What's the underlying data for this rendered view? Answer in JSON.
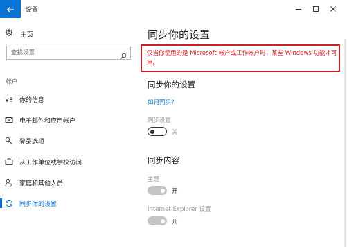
{
  "window": {
    "title": "设置",
    "back_icon": "arrow-left-icon",
    "controls": [
      "minimize-icon",
      "maximize-icon",
      "close-icon"
    ]
  },
  "sidebar": {
    "home_label": "主页",
    "search_placeholder": "查找设置",
    "section_label": "帐户",
    "items": [
      {
        "label": "你的信息",
        "icon": "person-card-icon",
        "active": false
      },
      {
        "label": "电子邮件和应用帐户",
        "icon": "mail-icon",
        "active": false
      },
      {
        "label": "登录选项",
        "icon": "key-icon",
        "active": false
      },
      {
        "label": "从工作单位或学校访问",
        "icon": "briefcase-icon",
        "active": false
      },
      {
        "label": "家庭和其他人员",
        "icon": "person-add-icon",
        "active": false
      },
      {
        "label": "同步你的设置",
        "icon": "sync-icon",
        "active": true
      }
    ]
  },
  "main": {
    "title": "同步你的设置",
    "warning": "仅当你使用的是 Microsoft 帐户或工作帐户时，某些 Windows 功能才可用。",
    "section1": {
      "heading": "同步你的设置",
      "link": "如何同步?",
      "setting_label": "同步设置",
      "toggle_state": "关",
      "toggle_on": false
    },
    "section2": {
      "heading": "同步内容",
      "items": [
        {
          "label": "主题",
          "state": "开",
          "on": true
        },
        {
          "label": "Internet Explorer 设置",
          "state": "开",
          "on": true
        }
      ]
    }
  },
  "colors": {
    "accent": "#0a74d6",
    "warning": "#d21f25"
  }
}
